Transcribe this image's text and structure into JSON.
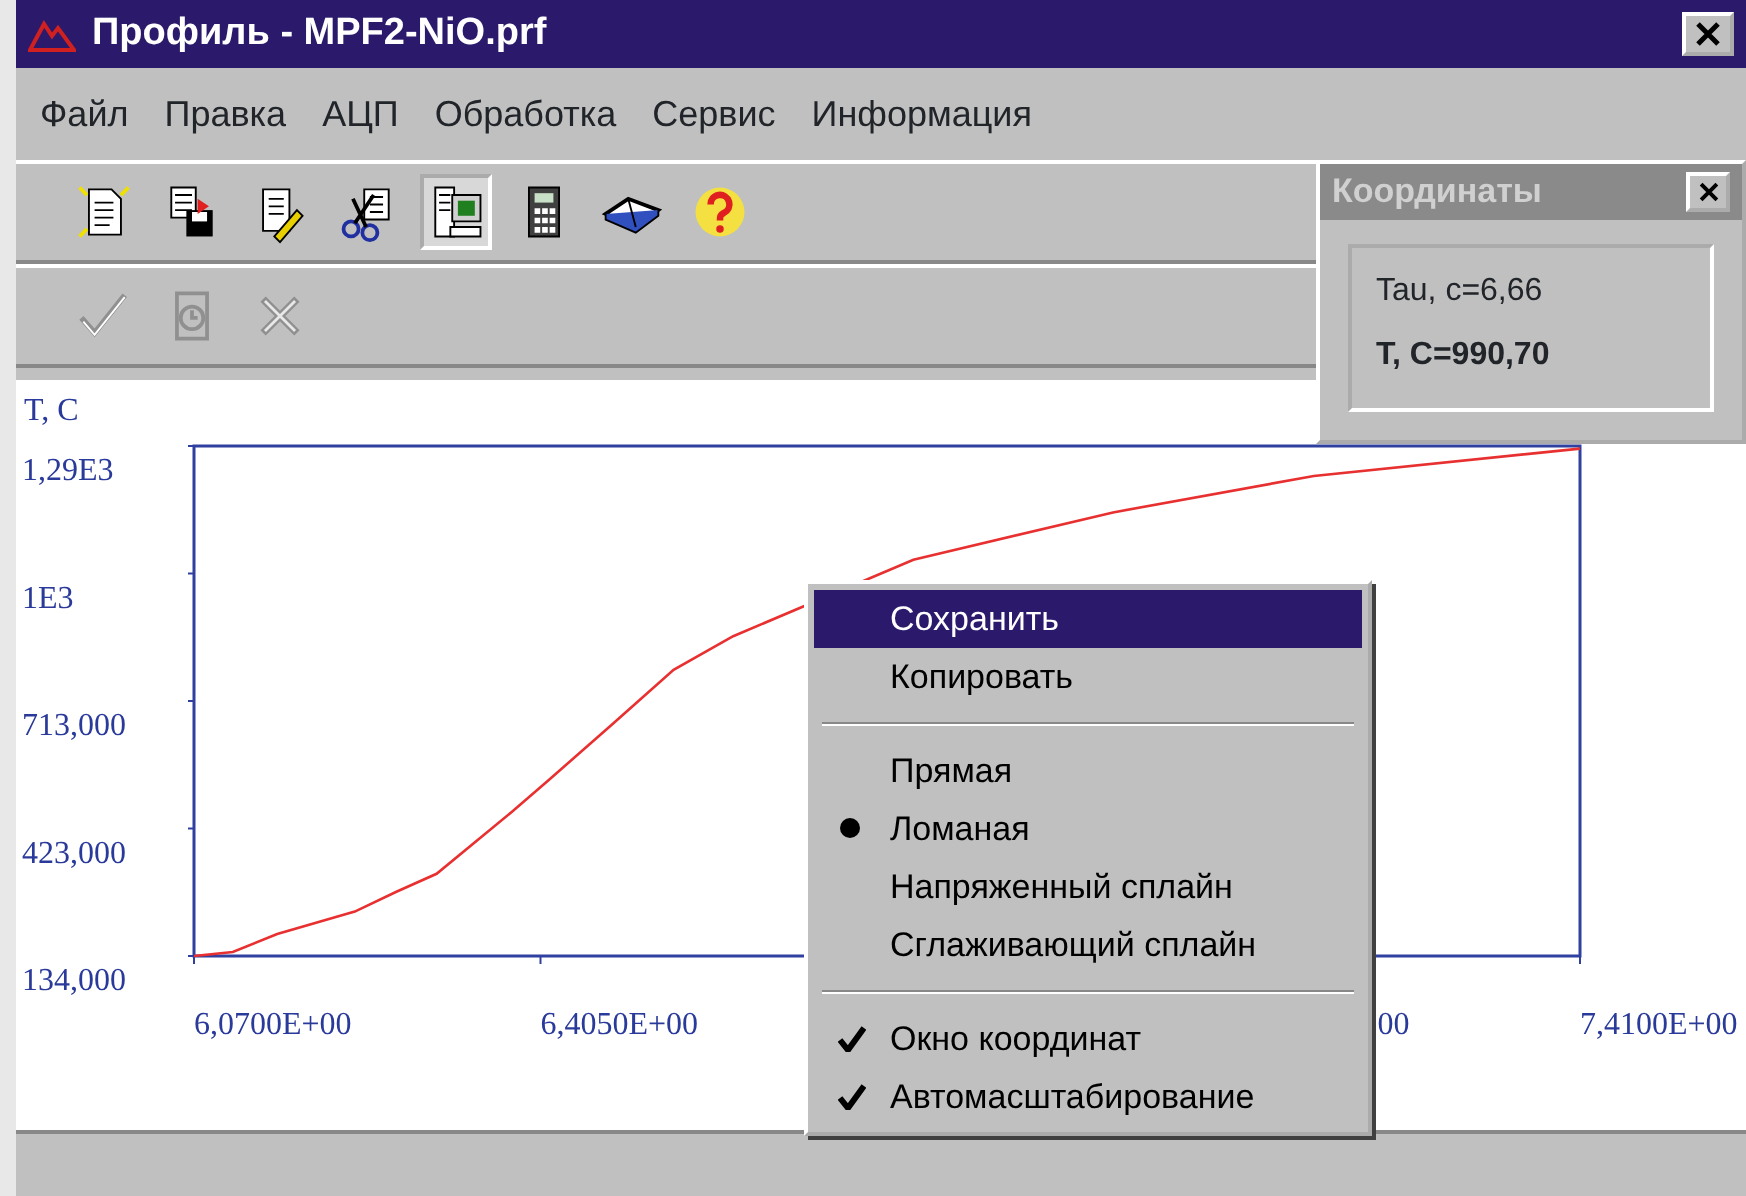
{
  "window": {
    "title": "Профиль - MPF2-NiO.prf"
  },
  "menu_bar": [
    "Файл",
    "Правка",
    "АЦП",
    "Обработка",
    "Сервис",
    "Информация"
  ],
  "toolbar": [
    {
      "kind": "new",
      "selected": false
    },
    {
      "kind": "save",
      "selected": false
    },
    {
      "kind": "edit",
      "selected": false
    },
    {
      "kind": "cut",
      "selected": false
    },
    {
      "kind": "monitor",
      "selected": true
    },
    {
      "kind": "calculator",
      "selected": false
    },
    {
      "kind": "book",
      "selected": false
    },
    {
      "kind": "help",
      "selected": false
    }
  ],
  "toolbar_2": [
    {
      "kind": "check",
      "disabled": true
    },
    {
      "kind": "clock",
      "disabled": true
    },
    {
      "kind": "cross",
      "disabled": true
    }
  ],
  "chart": {
    "y_axis_label": "T, C",
    "y_tick_labels": [
      "1,29E3",
      "1E3",
      "713,000",
      "423,000",
      "134,000"
    ],
    "x_tick_labels": [
      "6,0700E+00",
      "6,4050E+00",
      "00",
      "7,4100E+00"
    ]
  },
  "context_menu": [
    {
      "kind": "command",
      "label": "Сохранить",
      "selected": true
    },
    {
      "kind": "command",
      "label": "Копировать",
      "selected": false
    },
    {
      "kind": "separator"
    },
    {
      "kind": "radio",
      "label": "Прямая",
      "checked": false,
      "selected": false
    },
    {
      "kind": "radio",
      "label": "Ломаная",
      "checked": true,
      "selected": false
    },
    {
      "kind": "radio",
      "label": "Напряженный сплайн",
      "checked": false,
      "selected": false
    },
    {
      "kind": "radio",
      "label": "Сглаживающий сплайн",
      "checked": false,
      "selected": false
    },
    {
      "kind": "separator"
    },
    {
      "kind": "check",
      "label": "Окно координат",
      "checked": true,
      "selected": false
    },
    {
      "kind": "check",
      "label": "Автомасштабирование",
      "checked": true,
      "selected": false
    }
  ],
  "coordinates_window": {
    "title": "Координаты",
    "lines": [
      "Tau, c=6,66",
      "T, C=990,70"
    ]
  }
}
